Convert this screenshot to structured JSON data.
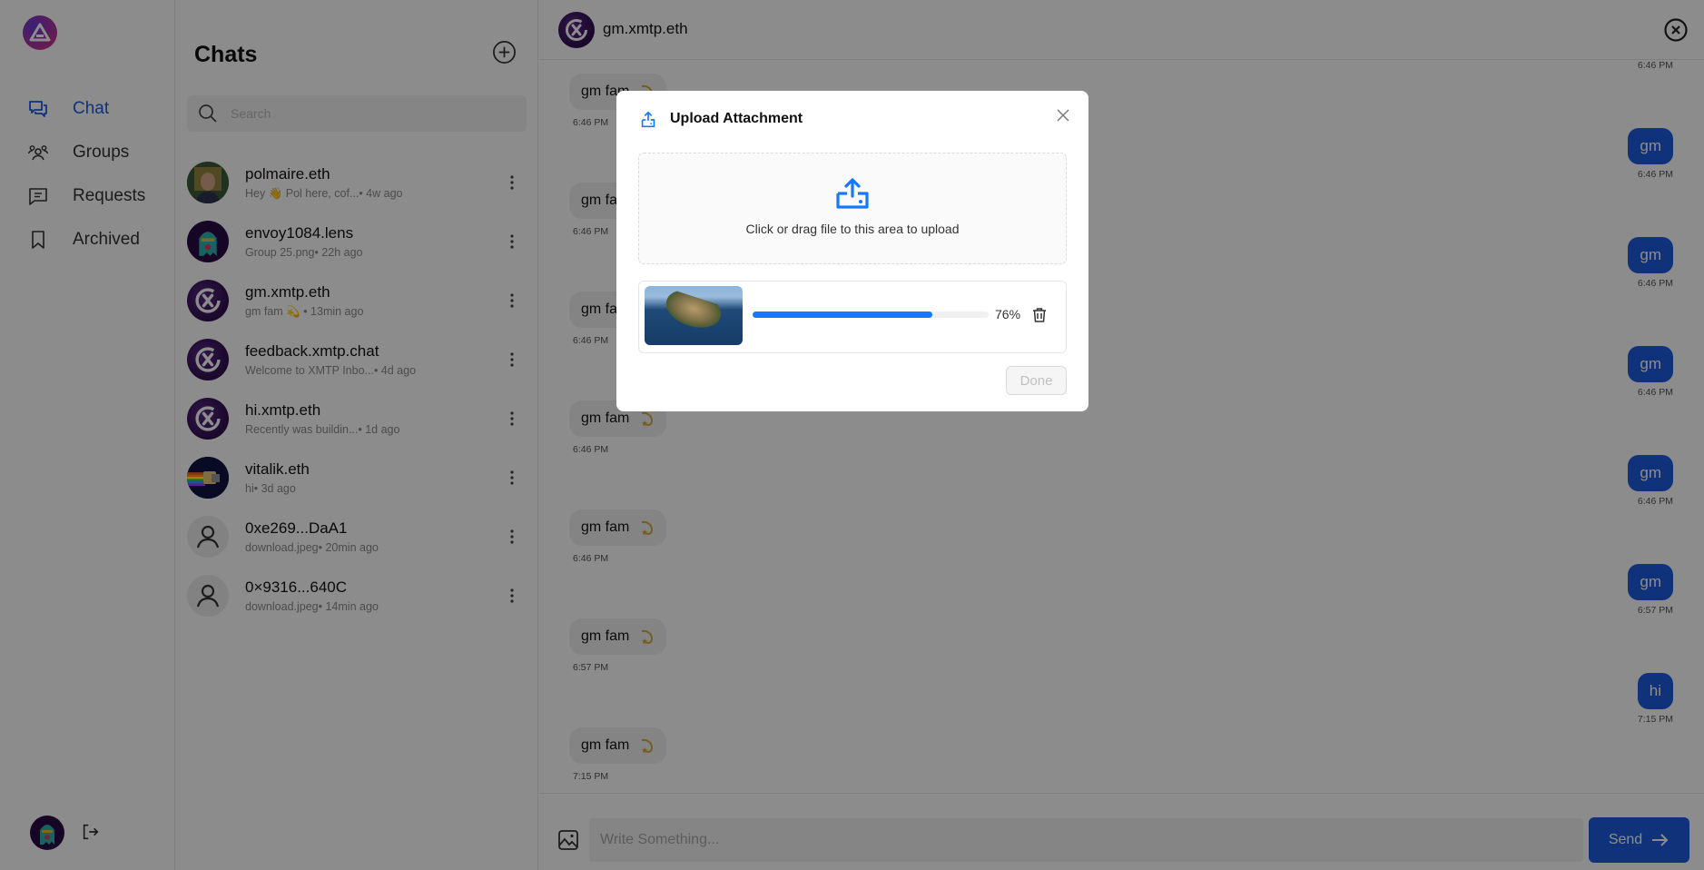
{
  "nav": {
    "items": [
      {
        "label": "Chat",
        "icon": "chat-bubbles-icon",
        "active": true
      },
      {
        "label": "Groups",
        "icon": "groups-icon",
        "active": false
      },
      {
        "label": "Requests",
        "icon": "requests-icon",
        "active": false
      },
      {
        "label": "Archived",
        "icon": "bookmark-icon",
        "active": false
      }
    ]
  },
  "chats": {
    "title": "Chats",
    "search_placeholder": "Search",
    "items": [
      {
        "name": "polmaire.eth",
        "preview": "Hey 👋 Pol here, cof...• 4w ago",
        "avatar": "photo"
      },
      {
        "name": "envoy1084.lens",
        "preview": "Group 25.png• 22h ago",
        "avatar": "ghost"
      },
      {
        "name": "gm.xmtp.eth",
        "preview": "gm fam 💫 • 13min ago",
        "avatar": "xmtp"
      },
      {
        "name": "feedback.xmtp.chat",
        "preview": "Welcome to XMTP Inbo...• 4d ago",
        "avatar": "xmtp"
      },
      {
        "name": "hi.xmtp.eth",
        "preview": "Recently was buildin...• 1d ago",
        "avatar": "xmtp"
      },
      {
        "name": "vitalik.eth",
        "preview": "hi• 3d ago",
        "avatar": "nyan"
      },
      {
        "name": "0xe269...DaA1",
        "preview": "download.jpeg• 20min ago",
        "avatar": "user"
      },
      {
        "name": "0×9316...640C",
        "preview": "download.jpeg• 14min ago",
        "avatar": "user"
      }
    ]
  },
  "conversation": {
    "title": "gm.xmtp.eth",
    "top_time": "6:46 PM",
    "messages_in": [
      {
        "text": "gm fam",
        "emoji": "💫",
        "time": "6:46 PM"
      },
      {
        "text": "gm fam",
        "emoji": "💫",
        "time": "6:46 PM"
      },
      {
        "text": "gm fam",
        "emoji": "💫",
        "time": "6:46 PM"
      },
      {
        "text": "gm fam",
        "emoji": "💫",
        "time": "6:46 PM"
      },
      {
        "text": "gm fam",
        "emoji": "💫",
        "time": "6:46 PM"
      },
      {
        "text": "gm fam",
        "emoji": "💫",
        "time": "6:57 PM"
      },
      {
        "text": "gm fam",
        "emoji": "💫",
        "time": "7:15 PM"
      }
    ],
    "messages_out": [
      {
        "text": "gm",
        "time": "6:46 PM"
      },
      {
        "text": "gm",
        "time": "6:46 PM"
      },
      {
        "text": "gm",
        "time": "6:46 PM"
      },
      {
        "text": "gm",
        "time": "6:46 PM"
      },
      {
        "text": "gm",
        "time": "6:57 PM"
      },
      {
        "text": "hi",
        "time": "7:15 PM"
      }
    ],
    "composer_placeholder": "Write Something...",
    "send_label": "Send"
  },
  "modal": {
    "title": "Upload Attachment",
    "dropzone_hint": "Click or drag file to this area to upload",
    "file": {
      "progress_percent": 76,
      "progress_label": "76%"
    },
    "done_label": "Done"
  },
  "colors": {
    "accent": "#1d5ce0",
    "progress": "#1677ff"
  }
}
